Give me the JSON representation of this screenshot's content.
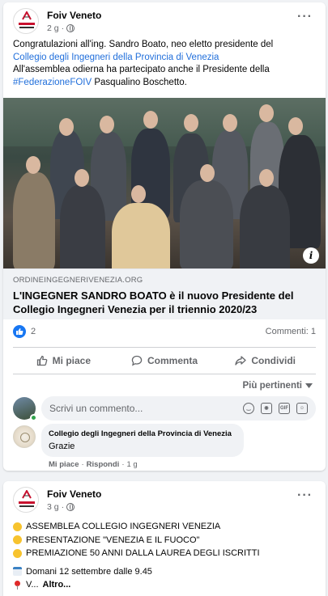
{
  "post1": {
    "author": "Foiv Veneto",
    "time": "2 g",
    "text_line1": "Congratulazioni all'ing. Sandro Boato, neo eletto presidente del",
    "text_link": "Collegio degli Ingegneri della Provincia di Venezia",
    "text_line3": "All'assemblea odierna ha partecipato anche il Presidente della",
    "hashtag": "#FederazioneFOIV",
    "text_tail": " Pasqualino Boschetto.",
    "link_domain": "ORDINEINGEGNERIVENEZIA.ORG",
    "link_title": "L'INGEGNER SANDRO BOATO è il nuovo Presidente del Collegio Ingegneri Venezia per il triennio 2020/23",
    "likes": "2",
    "comments": "Commenti: 1",
    "actions": {
      "like": "Mi piace",
      "comment": "Commenta",
      "share": "Condividi"
    },
    "sort_label": "Più pertinenti",
    "comment_placeholder": "Scrivi un commento...",
    "comment": {
      "author": "Collegio degli Ingegneri della Provincia di Venezia",
      "text": "Grazie",
      "like": "Mi piace",
      "sep": "·",
      "reply": "Rispondi",
      "time": "1 g"
    }
  },
  "post2": {
    "author": "Foiv Veneto",
    "time": "3 g",
    "items": [
      "ASSEMBLEA COLLEGIO INGEGNERI VENEZIA",
      "PRESENTAZIONE \"VENEZIA E IL FUOCO\"",
      "PREMIAZIONE 50 ANNI DALLA LAUREA DEGLI ISCRITTI"
    ],
    "date_line": "Domani 12 settembre dalle 9.45",
    "location_line": "V...",
    "more": "Altro..."
  },
  "colors": {
    "link": "#216fdb",
    "like_blue": "#1877f2",
    "muted": "#65676b",
    "brand_red": "#c8102e"
  }
}
